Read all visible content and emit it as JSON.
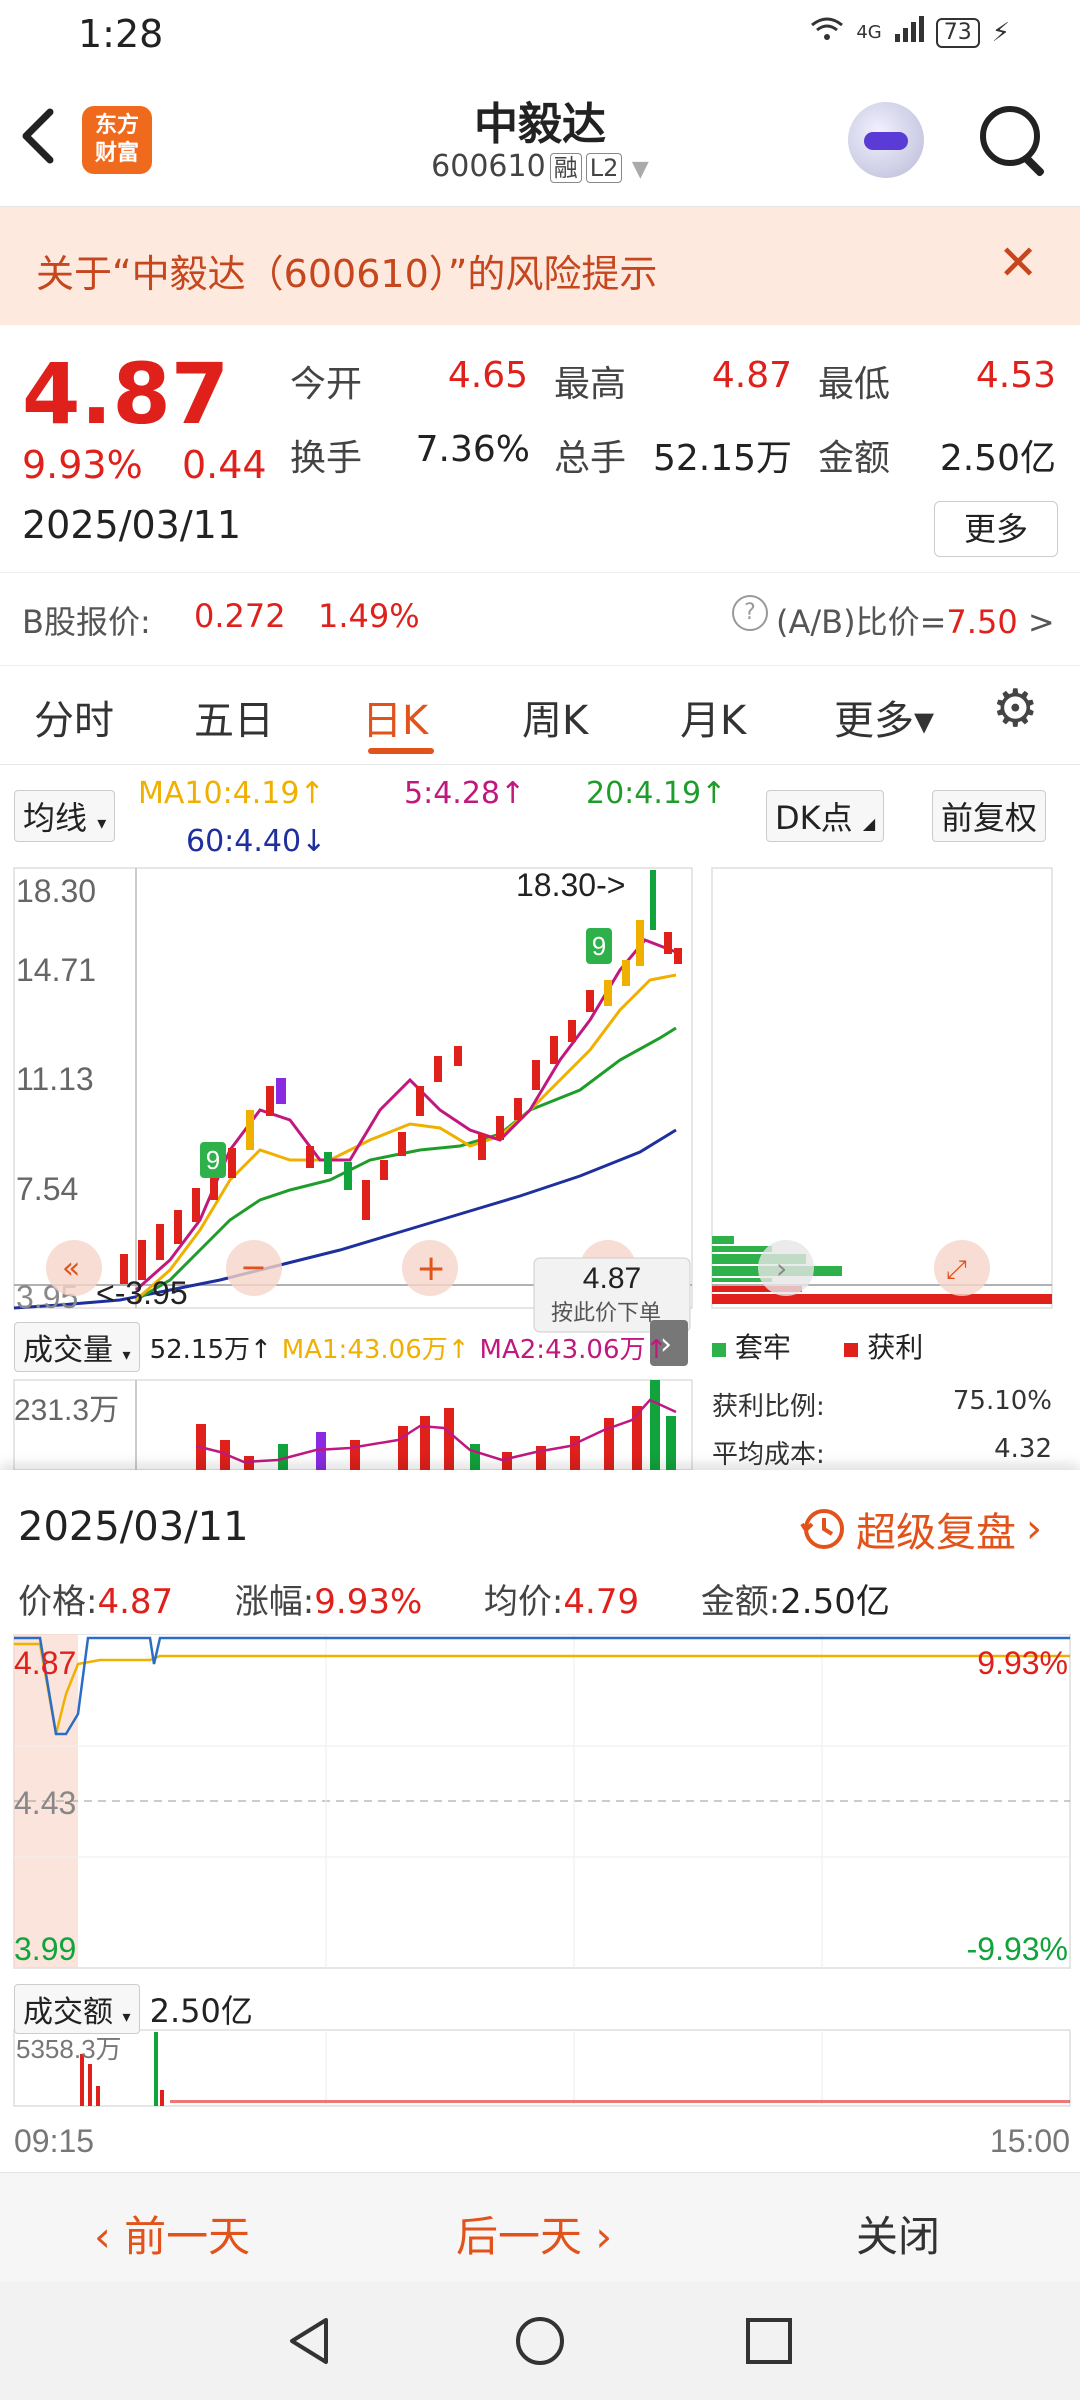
{
  "status_bar": {
    "time": "1:28",
    "network": "4G",
    "battery": "73"
  },
  "header": {
    "logo_text": "东方\n财富",
    "title": "中毅达",
    "code": "600610",
    "tag_margin": "融",
    "tag_level": "L2"
  },
  "risk_banner": {
    "text": "关于“中毅达（600610）”的风险提示"
  },
  "quote": {
    "price": "4.87",
    "change_pct": "9.93%",
    "change": "0.44",
    "date": "2025/03/11",
    "fields": [
      {
        "label": "今开",
        "value": "4.65",
        "color": "red"
      },
      {
        "label": "最高",
        "value": "4.87",
        "color": "red"
      },
      {
        "label": "最低",
        "value": "4.53",
        "color": "red"
      },
      {
        "label": "换手",
        "value": "7.36%",
        "color": "black"
      },
      {
        "label": "总手",
        "value": "52.15万",
        "color": "black"
      },
      {
        "label": "金额",
        "value": "2.50亿",
        "color": "black"
      }
    ],
    "more_label": "更多"
  },
  "bshare": {
    "label": "B股报价:",
    "price": "0.272",
    "pct": "1.49%",
    "ratio_label": "(A/B)比价=",
    "ratio_value": "7.50",
    "arrow": ">"
  },
  "tabs": [
    {
      "label": "分时",
      "active": false
    },
    {
      "label": "五日",
      "active": false
    },
    {
      "label": "日K",
      "active": true
    },
    {
      "label": "周K",
      "active": false
    },
    {
      "label": "月K",
      "active": false
    },
    {
      "label": "更多▾",
      "active": false
    }
  ],
  "kline": {
    "ma_selector": "均线",
    "ma10": "MA10:4.19↑",
    "ma5": "5:4.28↑",
    "ma20": "20:4.19↑",
    "ma60": "60:4.40↓",
    "dk_button": "DK点",
    "adjust_button": "前复权",
    "y_ticks": [
      "18.30",
      "14.71",
      "11.13",
      "7.54",
      "3.95"
    ],
    "high_marker": "18.30->",
    "low_marker": "<-3.95",
    "price_tag": "4.87",
    "price_tag_sub": "按此价下单",
    "signal_nine": "9",
    "colors": {
      "up": "#e0201b",
      "down": "#11a33c",
      "ma5": "#c0187e",
      "ma10": "#f0b000",
      "ma20": "#1f9d2a",
      "ma60": "#1e2f9e"
    }
  },
  "volume": {
    "selector": "成交量",
    "current": "52.15万↑",
    "ma1": "MA1:43.06万↑",
    "ma2": "MA2:43.06万↑",
    "y_tick": "231.3万"
  },
  "chips": {
    "legend_trapped": "套牢",
    "legend_profit": "获利",
    "profit_ratio_label": "获利比例:",
    "profit_ratio_value": "75.10%",
    "avg_cost_label": "平均成本:",
    "avg_cost_value": "4.32"
  },
  "detail": {
    "date": "2025/03/11",
    "replay_label": "超级复盘",
    "price_label": "价格:",
    "price_value": "4.87",
    "pct_label": "涨幅:",
    "pct_value": "9.93%",
    "avg_label": "均价:",
    "avg_value": "4.79",
    "amount_label": "金额:",
    "amount_value": "2.50亿",
    "y_top": "4.87",
    "y_mid": "4.43",
    "y_bottom": "3.99",
    "pct_top": "9.93%",
    "pct_bottom": "-9.93%",
    "turnover_selector": "成交额",
    "turnover_value": "2.50亿",
    "turnover_tick": "5358.3万",
    "time_start": "09:15",
    "time_end": "15:00"
  },
  "bottom_actions": {
    "prev": "‹ 前一天",
    "next": "后一天 ›",
    "close": "关闭"
  }
}
